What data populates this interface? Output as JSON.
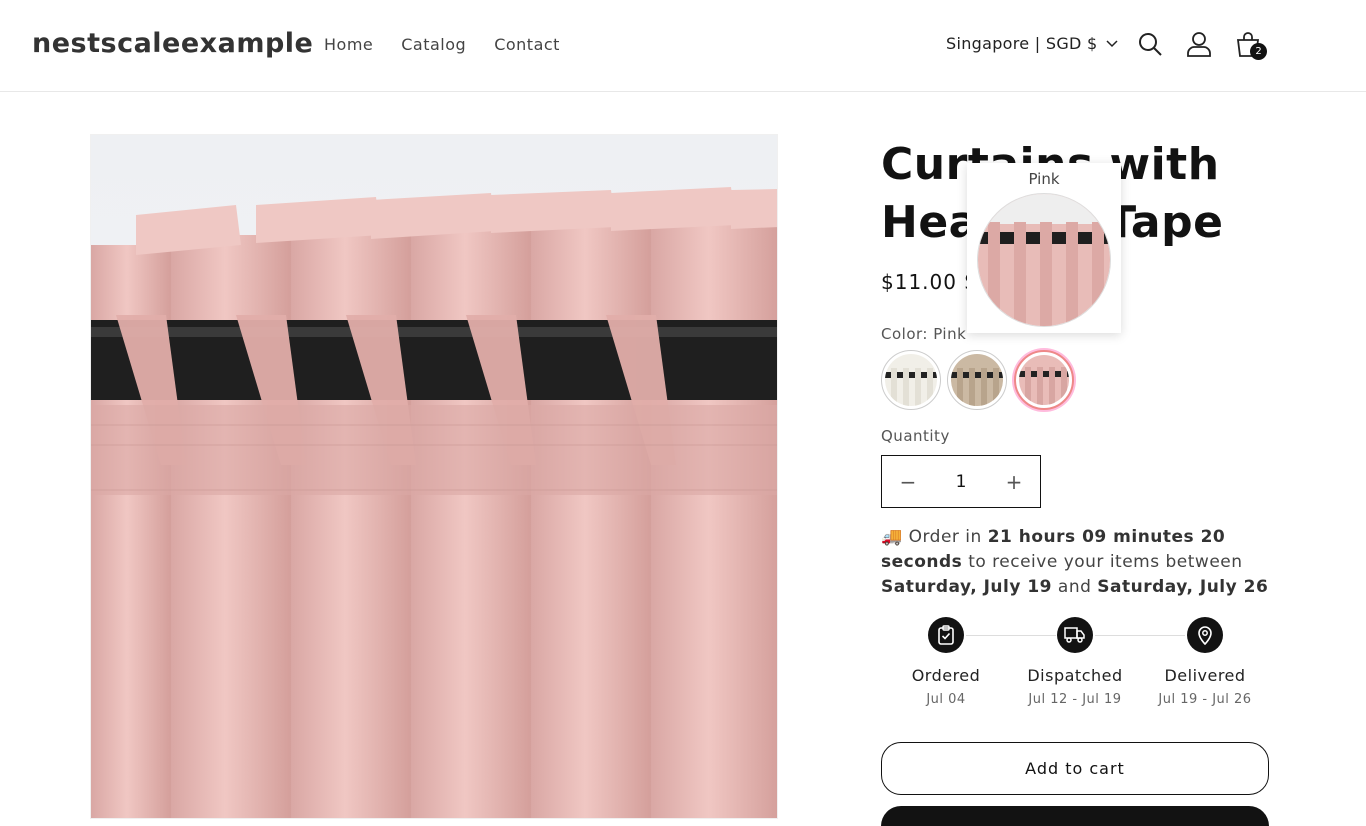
{
  "header": {
    "logo": "nestscaleexample",
    "nav": [
      "Home",
      "Catalog",
      "Contact"
    ],
    "locale": "Singapore | SGD $",
    "cart_count": "2"
  },
  "product": {
    "title_line1": "Curtains with",
    "title_line2": "Heading Tape",
    "price": "$11.00 SGD",
    "color_label": "Color: Pink",
    "swatches": [
      "White",
      "Beige",
      "Pink"
    ],
    "tooltip_label": "Pink",
    "quantity_label": "Quantity",
    "quantity_value": "1",
    "quantity_minus": "−",
    "quantity_plus": "+"
  },
  "eta": {
    "emoji": "🚚",
    "prefix": "Order in",
    "countdown": "21 hours 09 minutes 20 seconds",
    "middle": "to receive your items between",
    "date_from": "Saturday, July 19",
    "and": "and",
    "date_to": "Saturday, July 26"
  },
  "timeline": [
    {
      "label": "Ordered",
      "date": "Jul 04",
      "icon": "clipboard-check-icon"
    },
    {
      "label": "Dispatched",
      "date": "Jul 12 - Jul 19",
      "icon": "truck-icon"
    },
    {
      "label": "Delivered",
      "date": "Jul 19 - Jul 26",
      "icon": "map-pin-icon"
    }
  ],
  "buttons": {
    "add_to_cart": "Add to cart"
  },
  "colors": {
    "accent": "#121212",
    "curtain_pink": "#e5b7b4",
    "rod": "#1f1f1f"
  }
}
